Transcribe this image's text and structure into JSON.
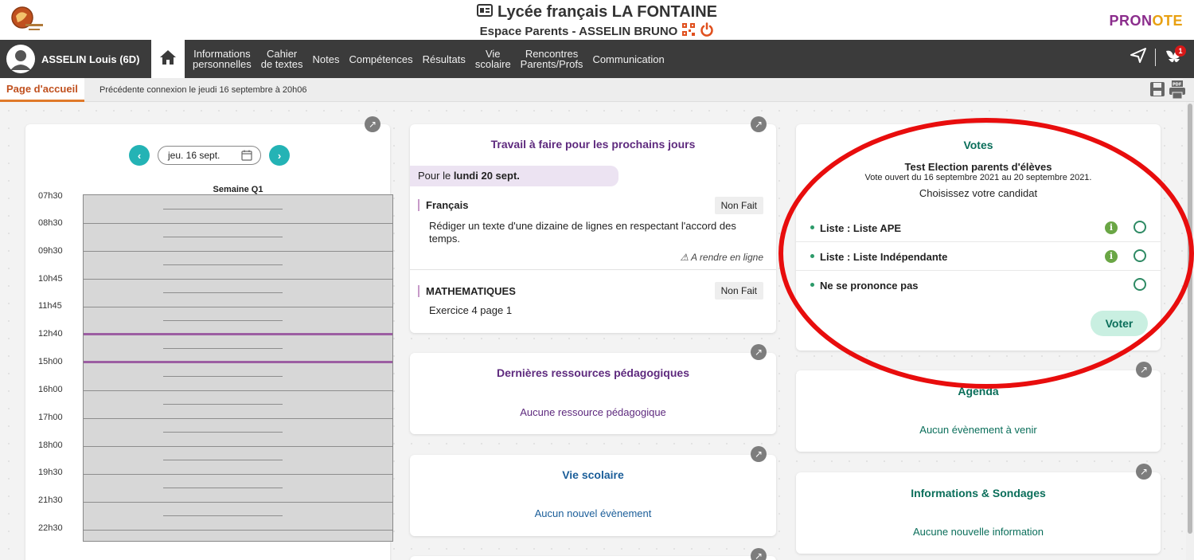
{
  "header": {
    "school_title": "Lycée français LA FONTAINE",
    "space_subtitle": "Espace Parents - ASSELIN BRUNO",
    "brand_p1": "PRON",
    "brand_p2": "OTE"
  },
  "nav": {
    "student": "ASSELIN Louis (6D)",
    "items": [
      "Informations\npersonnelles",
      "Cahier\nde textes",
      "Notes",
      "Compétences",
      "Résultats",
      "Vie\nscolaire",
      "Rencontres\nParents/Profs",
      "Communication"
    ],
    "notification_count": "1"
  },
  "breadcrumb": {
    "tab": "Page d'accueil",
    "previous_connection": "Précédente connexion le jeudi 16 septembre à 20h06"
  },
  "calendar": {
    "date": "jeu. 16 sept.",
    "week": "Semaine Q1",
    "hours": [
      "07h30",
      "08h30",
      "09h30",
      "10h45",
      "11h45",
      "12h40",
      "15h00",
      "16h00",
      "17h00",
      "18h00",
      "19h30",
      "21h30",
      "22h30"
    ]
  },
  "homework": {
    "title": "Travail à faire pour les prochains jours",
    "due_prefix": "Pour le ",
    "due_date": "lundi 20 sept.",
    "items": [
      {
        "subject": "Français",
        "status": "Non Fait",
        "text": "Rédiger un texte d'une dizaine de lignes en respectant l'accord des temps.",
        "note": "A rendre en ligne"
      },
      {
        "subject": "MATHEMATIQUES",
        "status": "Non Fait",
        "text": "Exercice 4 page 1"
      }
    ]
  },
  "resources": {
    "title": "Dernières ressources pédagogiques",
    "empty": "Aucune ressource pédagogique"
  },
  "vie_scolaire": {
    "title": "Vie scolaire",
    "empty": "Aucun nouvel évènement"
  },
  "votes": {
    "title": "Votes",
    "election": "Test Election parents d'élèves",
    "period": "Vote ouvert du 16 septembre 2021 au 20 septembre 2021.",
    "instruction": "Choisissez votre candidat",
    "options": [
      "Liste : Liste APE",
      "Liste : Liste Indépendante",
      "Ne se prononce pas"
    ],
    "submit": "Voter"
  },
  "agenda": {
    "title": "Agenda",
    "empty": "Aucun évènement à venir"
  },
  "infos": {
    "title": "Informations & Sondages",
    "empty": "Aucune nouvelle information"
  },
  "colors": {
    "accent_orange": "#e07a2a",
    "teal": "#24b3b5",
    "purple": "#5e2a7e",
    "green": "#0a6e5a",
    "annotation_red": "#e80d0d"
  }
}
